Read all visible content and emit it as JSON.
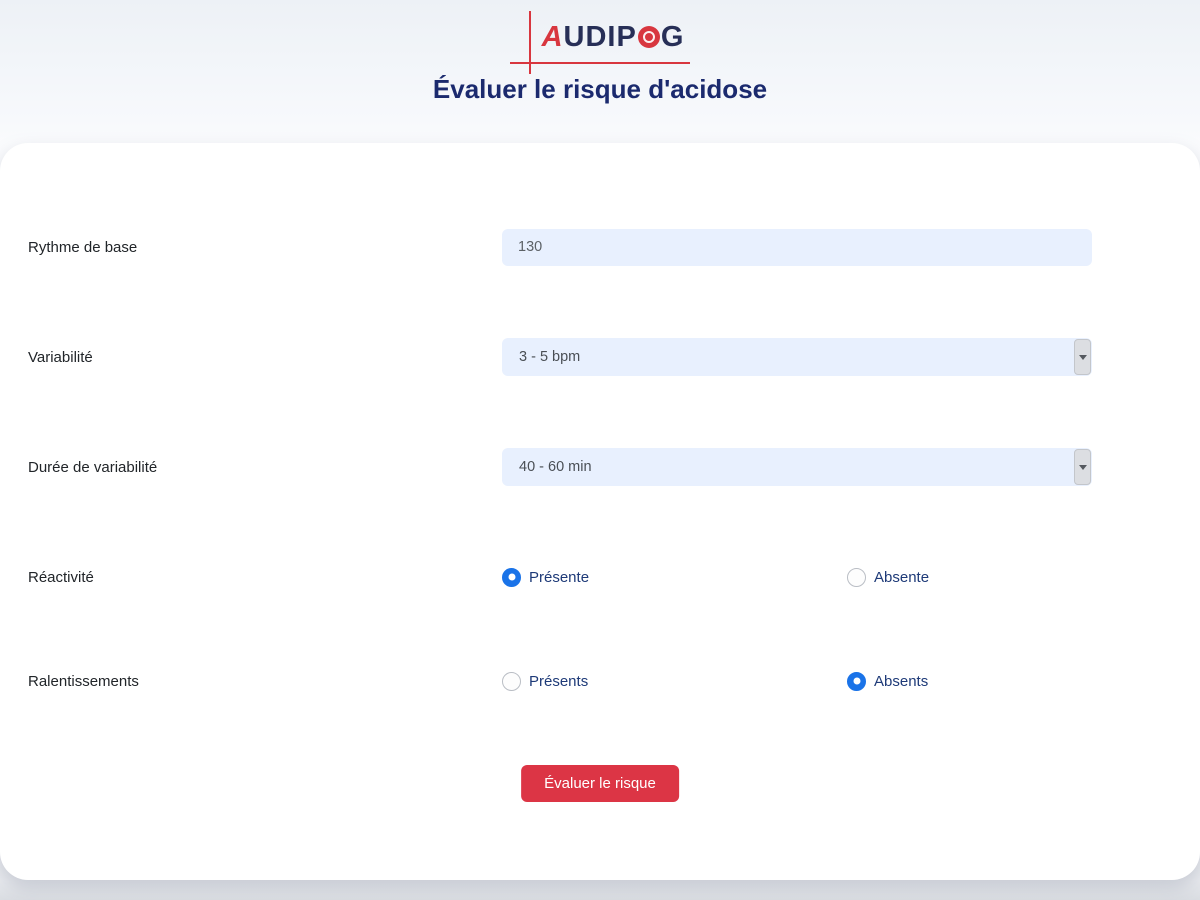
{
  "header": {
    "logo": {
      "letter_a": "A",
      "mid": "UDIP",
      "letter_g": "G"
    },
    "title": "Évaluer le risque d'acidose"
  },
  "form": {
    "fields": [
      {
        "label": "Rythme de base",
        "type": "text",
        "value": "130"
      },
      {
        "label": "Variabilité",
        "type": "select",
        "value": "3 - 5 bpm"
      },
      {
        "label": "Durée de variabilité",
        "type": "select",
        "value": "40 - 60 min"
      },
      {
        "label": "Réactivité",
        "type": "radio",
        "options": [
          {
            "label": "Présente",
            "selected": true
          },
          {
            "label": "Absente",
            "selected": false
          }
        ]
      },
      {
        "label": "Ralentissements",
        "type": "radio",
        "options": [
          {
            "label": "Présents",
            "selected": false
          },
          {
            "label": "Absents",
            "selected": true
          }
        ]
      }
    ],
    "submit_label": "Évaluer le risque"
  },
  "colors": {
    "accent_red": "#d8363f",
    "button_red": "#dc3545",
    "title_navy": "#1b2a6e",
    "radio_blue": "#1a73e8",
    "radio_label_navy": "#1e3a78",
    "field_bg_blue": "#e8f0fe"
  }
}
